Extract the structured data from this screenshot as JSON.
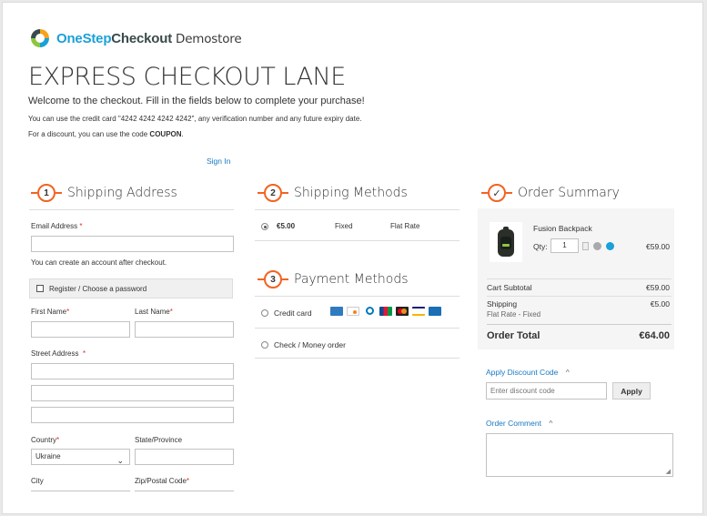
{
  "header": {
    "logo_part1": "OneStep",
    "logo_part2": "Checkout",
    "logo_part3": "Demostore",
    "title": "EXPRESS CHECKOUT LANE",
    "welcome": "Welcome to the checkout. Fill in the fields below to complete your purchase!",
    "hint_card": "You can use the credit card \"4242 4242 4242 4242\", any verification number and any future expiry date.",
    "hint_discount_prefix": "For a discount, you can use the code ",
    "hint_discount_code": "COUPON",
    "hint_discount_suffix": ".",
    "sign_in": "Sign In"
  },
  "shipping_address": {
    "step": "1",
    "title": "Shipping Address",
    "email_label": "Email Address",
    "email_value": "",
    "account_note": "You can create an account after checkout.",
    "register_label": "Register / Choose a password",
    "first_name_label": "First Name",
    "last_name_label": "Last Name",
    "street_label": "Street Address",
    "country_label": "Country",
    "country_value": "Ukraine",
    "state_label": "State/Province",
    "city_label": "City",
    "zip_label": "Zip/Postal Code",
    "required_mark": "*"
  },
  "shipping_methods": {
    "step": "2",
    "title": "Shipping Methods",
    "options": [
      {
        "price": "€5.00",
        "method": "Fixed",
        "carrier": "Flat Rate",
        "selected": true
      }
    ]
  },
  "payment_methods": {
    "step": "3",
    "title": "Payment Methods",
    "options": [
      {
        "label": "Credit card"
      },
      {
        "label": "Check / Money order"
      }
    ],
    "card_icons": [
      "amex-icon",
      "discover-icon",
      "diners-icon",
      "jcb-icon",
      "mastercard-icon",
      "visa-icon",
      "maestro-icon"
    ]
  },
  "order_summary": {
    "step": "✓",
    "title": "Order Summary",
    "product_name": "Fusion Backpack",
    "qty_label": "Qty:",
    "qty_value": "1",
    "product_price": "€59.00",
    "cart_subtotal_label": "Cart Subtotal",
    "cart_subtotal_value": "€59.00",
    "shipping_label": "Shipping",
    "shipping_value": "€5.00",
    "shipping_method": "Flat Rate - Fixed",
    "order_total_label": "Order Total",
    "order_total_value": "€64.00"
  },
  "discount": {
    "toggle_label": "Apply Discount Code",
    "placeholder": "Enter discount code",
    "apply_label": "Apply"
  },
  "comment": {
    "toggle_label": "Order Comment"
  },
  "colors": {
    "accent": "#f26322",
    "link": "#1979c3"
  }
}
